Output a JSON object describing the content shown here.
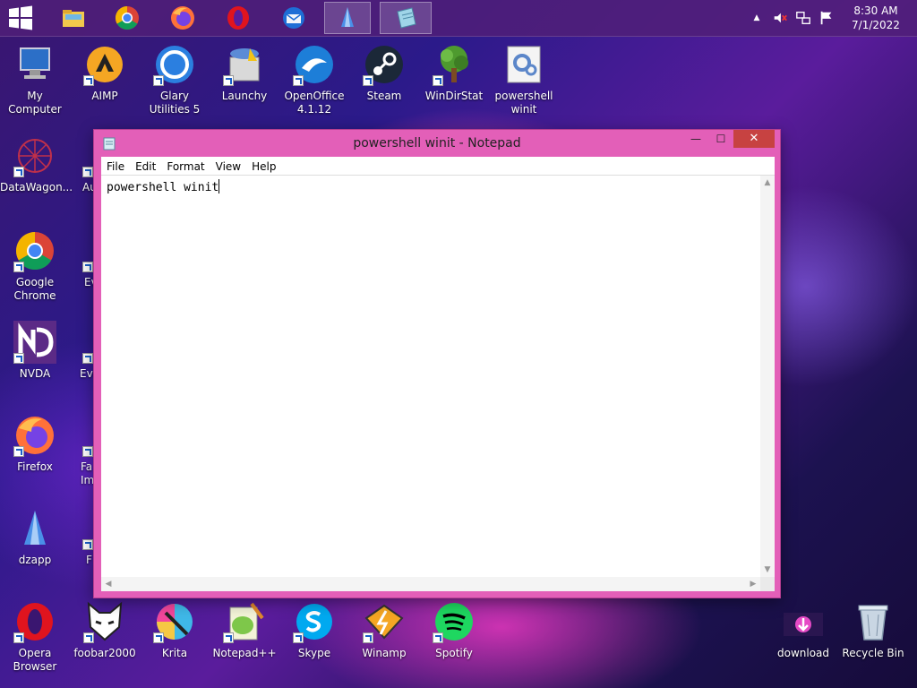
{
  "taskbar": {
    "apps": [
      {
        "name": "start",
        "icon": "windows-logo-icon"
      },
      {
        "name": "file-explorer",
        "icon": "folder-icon"
      },
      {
        "name": "chrome",
        "icon": "chrome-icon"
      },
      {
        "name": "firefox",
        "icon": "firefox-icon"
      },
      {
        "name": "opera",
        "icon": "opera-icon"
      },
      {
        "name": "thunderbird",
        "icon": "thunderbird-icon"
      },
      {
        "name": "dzapp",
        "icon": "dzapp-icon"
      },
      {
        "name": "notepad",
        "icon": "notepad-icon"
      }
    ],
    "tray": {
      "overflow": "▲",
      "clock_time": "8:30 AM",
      "clock_date": "7/1/2022"
    }
  },
  "desktop": {
    "icons": [
      {
        "label": "My Computer"
      },
      {
        "label": "AIMP"
      },
      {
        "label": "Glary Utilities 5"
      },
      {
        "label": "Launchy"
      },
      {
        "label": "OpenOffice 4.1.12"
      },
      {
        "label": "Steam"
      },
      {
        "label": "WinDirStat"
      },
      {
        "label": "powershell winit"
      },
      {
        "label": "DataWagon..."
      },
      {
        "label": "Au"
      },
      {
        "label": "Google Chrome"
      },
      {
        "label": "Ev"
      },
      {
        "label": "NVDA"
      },
      {
        "label": "Eve"
      },
      {
        "label": "Firefox"
      },
      {
        "label": "Fa Imag"
      },
      {
        "label": "dzapp"
      },
      {
        "label": "F"
      },
      {
        "label": "Opera Browser"
      },
      {
        "label": "foobar2000"
      },
      {
        "label": "Krita"
      },
      {
        "label": "Notepad++"
      },
      {
        "label": "Skype"
      },
      {
        "label": "Winamp"
      },
      {
        "label": "Spotify"
      },
      {
        "label": "download"
      },
      {
        "label": "Recycle Bin"
      }
    ]
  },
  "notepad": {
    "title": "powershell winit - Notepad",
    "minimize": "—",
    "maximize": "☐",
    "close": "✕",
    "menu": [
      "File",
      "Edit",
      "Format",
      "View",
      "Help"
    ],
    "content": "powershell winit"
  },
  "colors": {
    "window_frame": "#e35fb8",
    "close_button": "#c74241"
  }
}
